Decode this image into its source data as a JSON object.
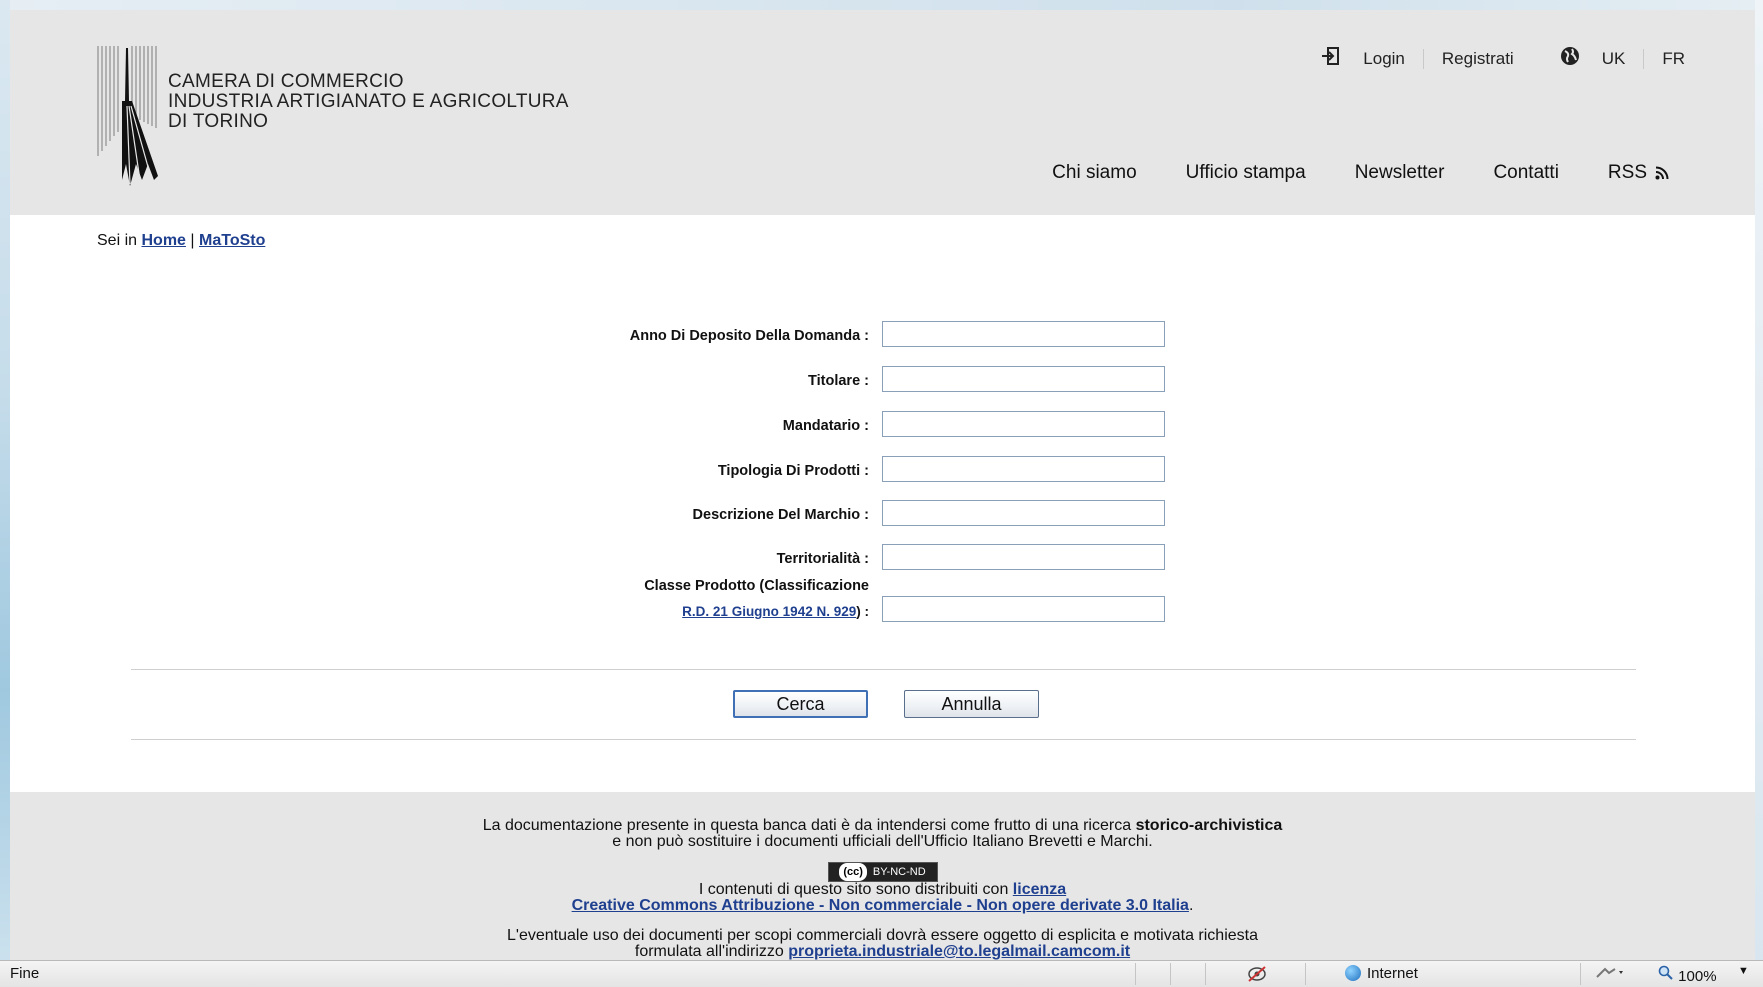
{
  "header": {
    "logo_lines": [
      "CAMERA DI COMMERCIO",
      "INDUSTRIA ARTIGIANATO E AGRICOLTURA",
      "DI TORINO"
    ],
    "top_links": {
      "login": "Login",
      "register": "Registrati",
      "lang_uk": "UK",
      "lang_fr": "FR"
    },
    "nav": [
      "Chi siamo",
      "Ufficio stampa",
      "Newsletter",
      "Contatti",
      "RSS"
    ]
  },
  "breadcrumb": {
    "prefix": "Sei in",
    "home": "Home",
    "separator": "|",
    "current": "MaToSto"
  },
  "form": {
    "fields": [
      {
        "label": "Anno Di Deposito Della Domanda :",
        "value": ""
      },
      {
        "label": "Titolare :",
        "value": ""
      },
      {
        "label": "Mandatario :",
        "value": ""
      },
      {
        "label": "Tipologia Di Prodotti :",
        "value": ""
      },
      {
        "label": "Descrizione Del Marchio :",
        "value": ""
      },
      {
        "label": "Territorialità :",
        "value": ""
      }
    ],
    "classe": {
      "label_line1": "Classe Prodotto (Classificazione",
      "link": "R.D. 21 Giugno 1942 N. 929",
      "label_suffix": ") :",
      "value": ""
    },
    "buttons": {
      "search": "Cerca",
      "cancel": "Annulla"
    }
  },
  "footer": {
    "line1_a": "La documentazione presente in questa banca dati è da intendersi come frutto di una ricerca",
    "line1_bold": "storico-archivistica",
    "line2": "e non può sostituire i documenti ufficiali dell'Ufficio Italiano Brevetti e Marchi.",
    "cc_badge_cc": "(cc)",
    "cc_badge_text": "BY-NC-ND",
    "license_prefix": "I contenuti di questo sito sono distribuiti con",
    "license_link1": "licenza",
    "license_link2": "Creative Commons Attribuzione - Non commerciale - Non opere derivate 3.0 Italia",
    "license_suffix": ".",
    "usage_line": "L'eventuale uso dei documenti per scopi commerciali dovrà essere oggetto di esplicita e motivata richiesta",
    "usage_prefix": "formulata all'indirizzo",
    "email": "proprieta.industriale@to.legalmail.camcom.it"
  },
  "statusbar": {
    "status": "Fine",
    "zone": "Internet",
    "zoom": "100%"
  }
}
